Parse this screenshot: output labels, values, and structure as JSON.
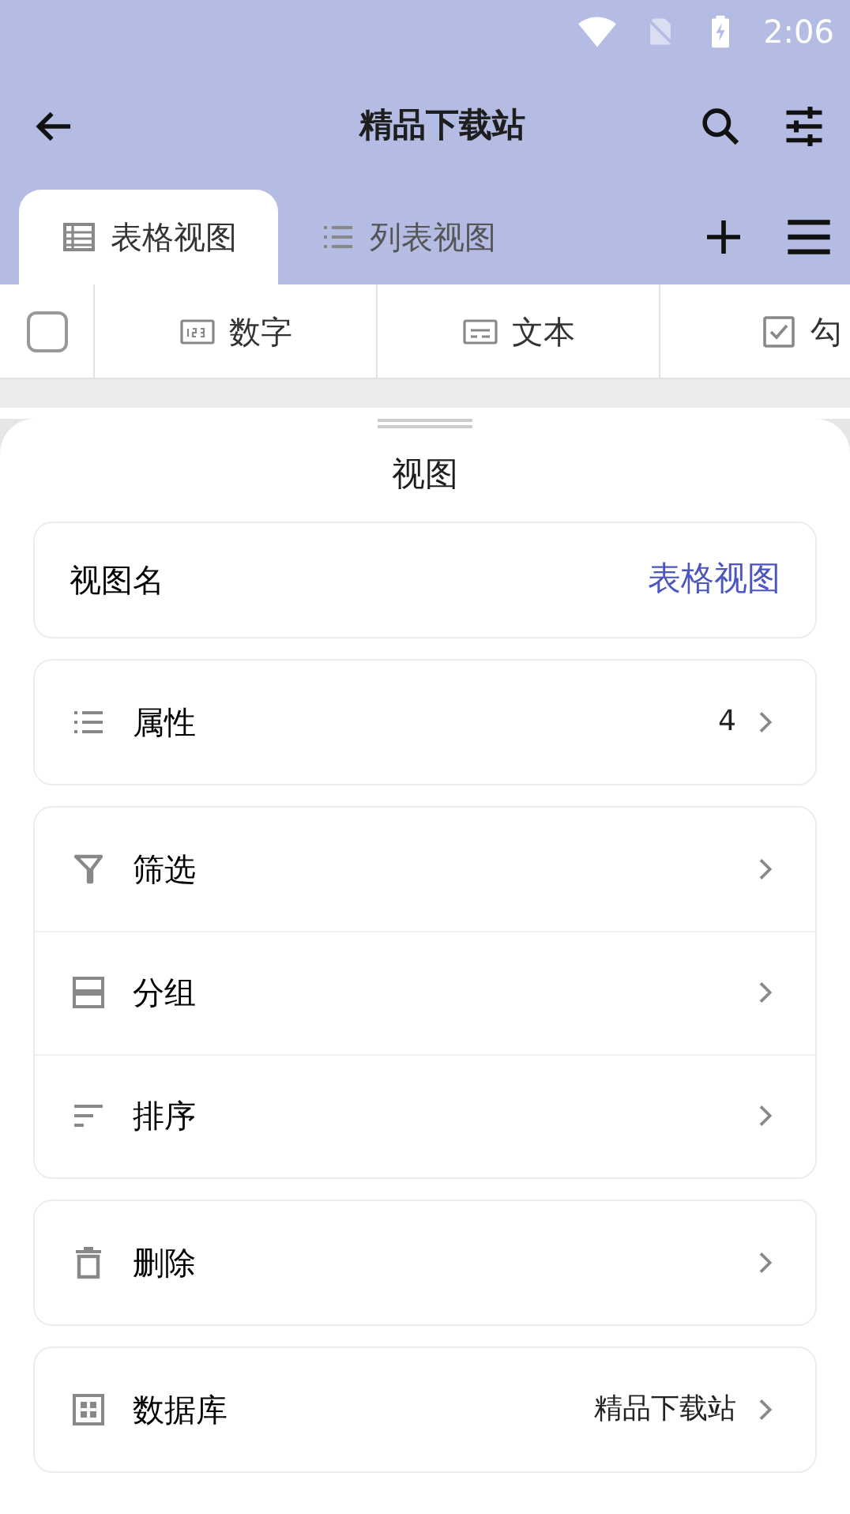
{
  "status_bar": {
    "time": "2:06"
  },
  "app_bar": {
    "title": "精品下载站"
  },
  "tabs": [
    {
      "label": "表格视图",
      "selected": true
    },
    {
      "label": "列表视图",
      "selected": false
    }
  ],
  "table": {
    "select_all": {
      "checked": false
    },
    "columns": [
      {
        "label": "数字"
      },
      {
        "label": "文本"
      },
      {
        "label": "勾"
      }
    ]
  },
  "sheet": {
    "title": "视图",
    "groups": [
      {
        "items": [
          {
            "kind": "value",
            "label": "视图名",
            "value": "表格视图"
          }
        ]
      },
      {
        "items": [
          {
            "kind": "nav",
            "label": "属性",
            "value": "4"
          }
        ]
      },
      {
        "items": [
          {
            "kind": "nav",
            "label": "筛选"
          },
          {
            "kind": "nav",
            "label": "分组"
          },
          {
            "kind": "nav",
            "label": "排序"
          }
        ]
      },
      {
        "items": [
          {
            "kind": "nav",
            "label": "删除"
          }
        ]
      },
      {
        "items": [
          {
            "kind": "nav",
            "label": "数据库",
            "value": "精品下载站"
          }
        ]
      }
    ]
  }
}
